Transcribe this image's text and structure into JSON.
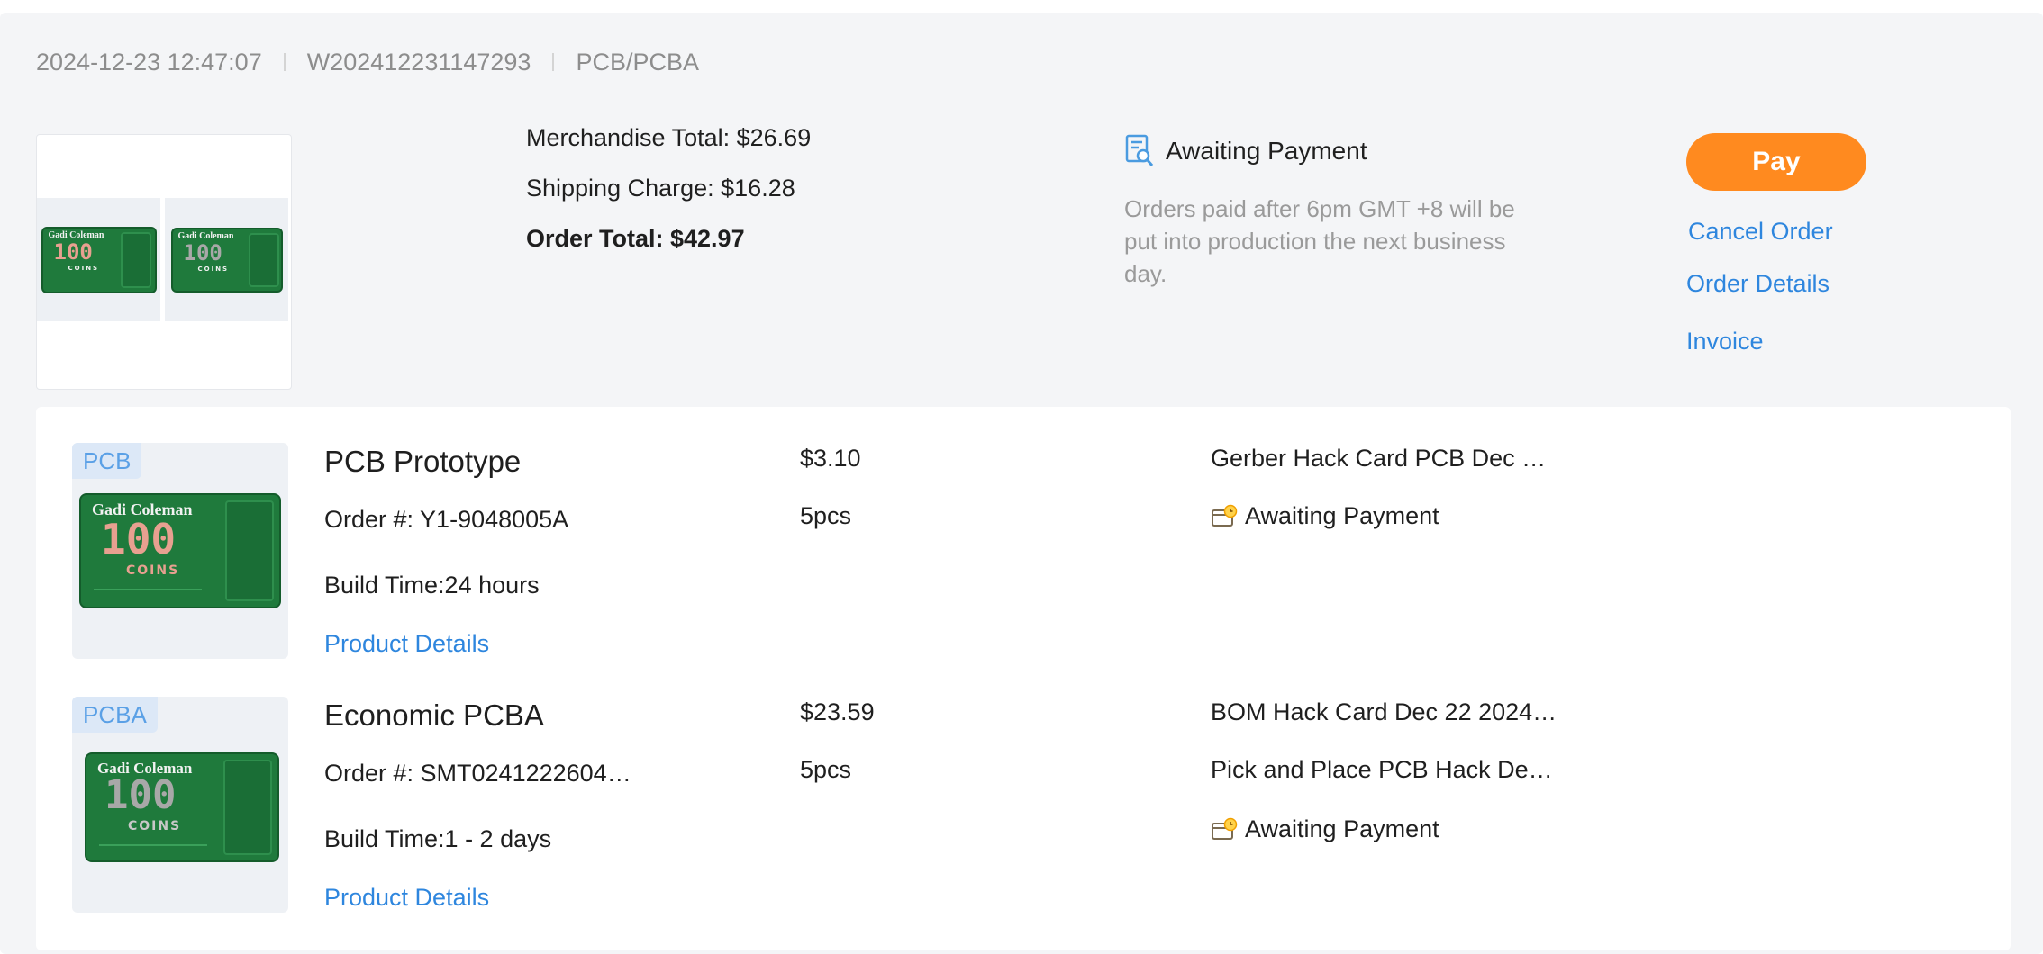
{
  "order": {
    "date": "2024-12-23 12:47:07",
    "number": "W202412231147293",
    "type": "PCB/PCBA"
  },
  "summary": {
    "merchandise_total": "Merchandise Total: $26.69",
    "shipping_charge": "Shipping Charge: $16.28",
    "order_total": "Order Total: $42.97"
  },
  "status": {
    "label": "Awaiting Payment",
    "note": "Orders paid after 6pm GMT +8 will be put into production the next business day."
  },
  "actions": {
    "pay": "Pay",
    "cancel": "Cancel Order",
    "details": "Order Details",
    "invoice": "Invoice"
  },
  "board_art": {
    "name": "Gadi Coleman",
    "number": "100",
    "word": "COINS",
    "accent_pcb": "#e8a090",
    "accent_pcba": "#a8a8a8"
  },
  "items": [
    {
      "tag": "PCB",
      "name": "PCB Prototype",
      "order_no": "Order #: Y1-9048005A",
      "build_time": "Build Time:24 hours",
      "details_link": "Product Details",
      "price": "$3.10",
      "qty": "5pcs",
      "file1": "Gerber Hack Card PCB Dec …",
      "status": "Awaiting Payment"
    },
    {
      "tag": "PCBA",
      "name": "Economic PCBA",
      "order_no": "Order #: SMT0241222604…",
      "build_time": "Build Time:1 - 2 days",
      "details_link": "Product Details",
      "price": "$23.59",
      "qty": "5pcs",
      "file1": "BOM Hack Card Dec 22 2024…",
      "file2": "Pick and Place PCB Hack De…",
      "status": "Awaiting Payment"
    }
  ],
  "colors": {
    "accent_orange": "#ff8a1f",
    "link_blue": "#2e86de",
    "panel_bg": "#f4f5f7"
  }
}
